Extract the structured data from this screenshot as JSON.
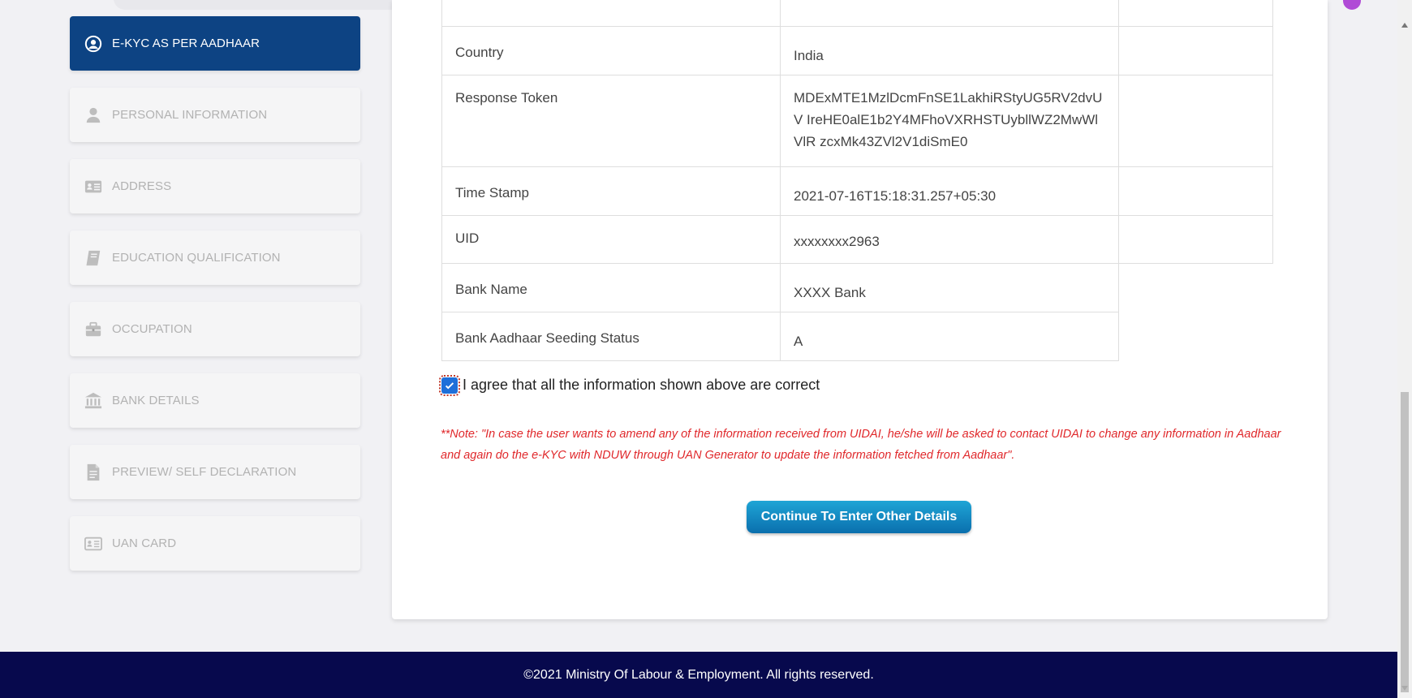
{
  "sidebar": {
    "items": [
      {
        "label": "E-KYC AS PER AADHAAR",
        "icon": "user-circle-icon",
        "active": true
      },
      {
        "label": "PERSONAL INFORMATION",
        "icon": "user-icon",
        "active": false
      },
      {
        "label": "ADDRESS",
        "icon": "address-card-icon",
        "active": false
      },
      {
        "label": "EDUCATION QUALIFICATION",
        "icon": "book-icon",
        "active": false
      },
      {
        "label": "OCCUPATION",
        "icon": "briefcase-icon",
        "active": false
      },
      {
        "label": "BANK DETAILS",
        "icon": "bank-icon",
        "active": false
      },
      {
        "label": "PREVIEW/ SELF DECLARATION",
        "icon": "document-icon",
        "active": false
      },
      {
        "label": "UAN CARD",
        "icon": "id-card-icon",
        "active": false
      }
    ]
  },
  "table": {
    "rows": [
      {
        "key": "Country",
        "value": "India"
      },
      {
        "key": "Response Token",
        "value": "MDExMTE1MzlDcmFnSE1LakhiRStyUG5RV2dvUV IreHE0alE1b2Y4MFhoVXRHSTUybllWZ2MwWlVlR zcxMk43ZVl2V1diSmE0"
      },
      {
        "key": "Time Stamp",
        "value": "2021-07-16T15:18:31.257+05:30"
      },
      {
        "key": "UID",
        "value": "xxxxxxxx2963"
      },
      {
        "key": "Bank Name",
        "value": "XXXX Bank"
      },
      {
        "key": "Bank Aadhaar Seeding Status",
        "value": "A"
      }
    ]
  },
  "agreement": {
    "label": "I agree that all the information shown above are correct",
    "checked": true
  },
  "note": "**Note: \"In case the user wants to amend any of the information received from UIDAI, he/she will be asked to contact UIDAI to change any information in Aadhaar and again do the e-KYC with NDUW through UAN Generator to update the information fetched from Aadhaar\".",
  "continue_button": "Continue To Enter Other Details",
  "footer": "©2021 Ministry Of Labour & Employment. All rights reserved.",
  "colors": {
    "active_sidebar": "#0d4383",
    "footer_bg": "#07094d",
    "note_red": "#e0282b",
    "button": "#0a6fad"
  }
}
